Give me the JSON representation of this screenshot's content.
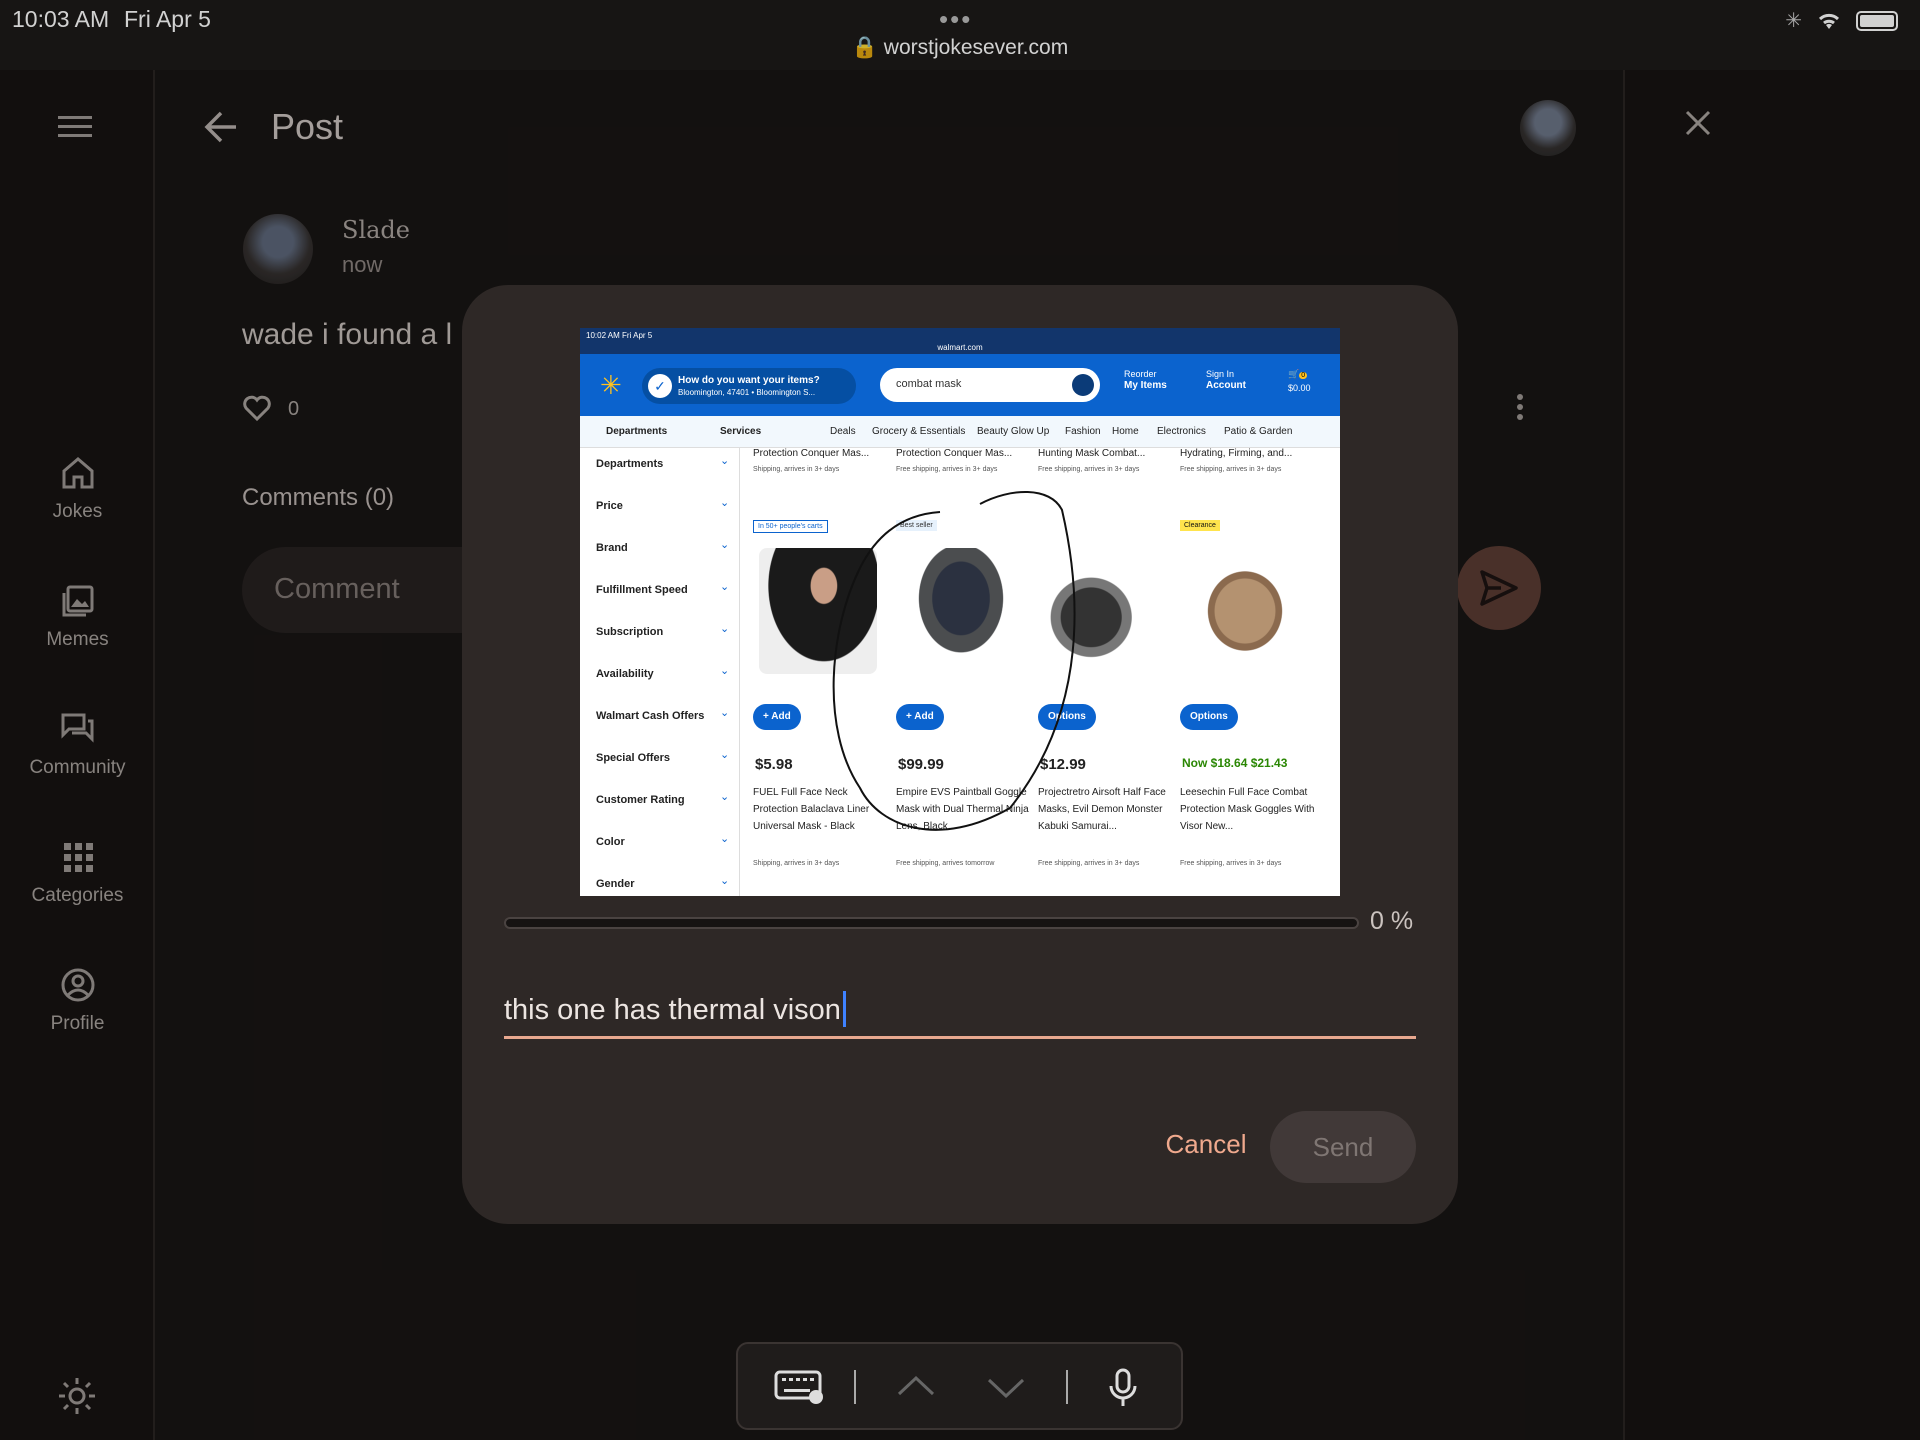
{
  "status_bar": {
    "time": "10:03 AM",
    "date": "Fri Apr 5",
    "dots": "•••",
    "url": "worstjokesever.com"
  },
  "sidebar": {
    "items": [
      {
        "label": "Jokes",
        "icon": "home-icon"
      },
      {
        "label": "Memes",
        "icon": "gallery-icon"
      },
      {
        "label": "Community",
        "icon": "chat-icon"
      },
      {
        "label": "Categories",
        "icon": "grid-icon"
      },
      {
        "label": "Profile",
        "icon": "account-icon"
      }
    ]
  },
  "header": {
    "title": "Post"
  },
  "post": {
    "author": "Slade",
    "time": "now",
    "text": "wade i found a l",
    "likes": "0"
  },
  "comments": {
    "heading": "Comments (0)",
    "placeholder": "Comment"
  },
  "dialog": {
    "progress": {
      "percent_value": 0,
      "label": "0 %"
    },
    "caption": "this one has thermal vison",
    "cancel_label": "Cancel",
    "send_label": "Send",
    "attachment": {
      "status_time": "10:02 AM   Fri Apr 5",
      "status_url": "walmart.com",
      "delivery_title": "How do you want your items?",
      "delivery_sub": "Bloomington, 47401 • Bloomington S...",
      "search_value": "combat mask",
      "reorder_top": "Reorder",
      "reorder_bottom": "My Items",
      "signin_top": "Sign In",
      "signin_bottom": "Account",
      "cart_total": "$0.00",
      "cart_count": "0",
      "nav": [
        "Departments",
        "Services",
        "Deals",
        "Grocery & Essentials",
        "Beauty Glow Up",
        "Fashion",
        "Home",
        "Electronics",
        "Patio & Garden"
      ],
      "filters": [
        "Departments",
        "Price",
        "Brand",
        "Fulfillment Speed",
        "Subscription",
        "Availability",
        "Walmart Cash Offers",
        "Special Offers",
        "Customer Rating",
        "Color",
        "Gender"
      ],
      "products": [
        {
          "top_title": "Protection Conquer Mas...",
          "top_ship": "Shipping, arrives in 3+ days",
          "badge": "In 50+ people's carts",
          "button": "+ Add",
          "price": "$5.98",
          "name": "FUEL Full Face Neck Protection Balaclava Liner Universal Mask - Black",
          "ship": "Shipping, arrives in 3+ days"
        },
        {
          "top_title": "Protection Conquer Mas...",
          "top_ship": "Free shipping, arrives in 3+ days",
          "badge": "Best seller",
          "button": "+ Add",
          "price": "$99.99",
          "name": "Empire EVS Paintball Goggle Mask with Dual Thermal Ninja Lens, Black...",
          "ship": "Free shipping, arrives tomorrow"
        },
        {
          "top_title": "Hunting Mask Combat...",
          "top_ship": "Free shipping, arrives in 3+ days",
          "badge": "",
          "button": "Options",
          "price": "$12.99",
          "name": "Projectretro Airsoft Half Face Masks, Evil Demon Monster Kabuki Samurai...",
          "ship": "Free shipping, arrives in 3+ days"
        },
        {
          "top_title": "Hydrating, Firming, and...",
          "top_ship": "Free shipping, arrives in 3+ days",
          "badge": "Clearance",
          "button": "Options",
          "price": "Now $18.64 $21.43",
          "name": "Leesechin Full Face Combat Protection Mask Goggles With Visor New...",
          "ship": "Free shipping, arrives in 3+ days"
        }
      ]
    }
  },
  "colors": {
    "accent": "#f0a98d",
    "background": "#181514",
    "dialog": "#2e2826",
    "walmart_blue": "#0b63ce"
  }
}
